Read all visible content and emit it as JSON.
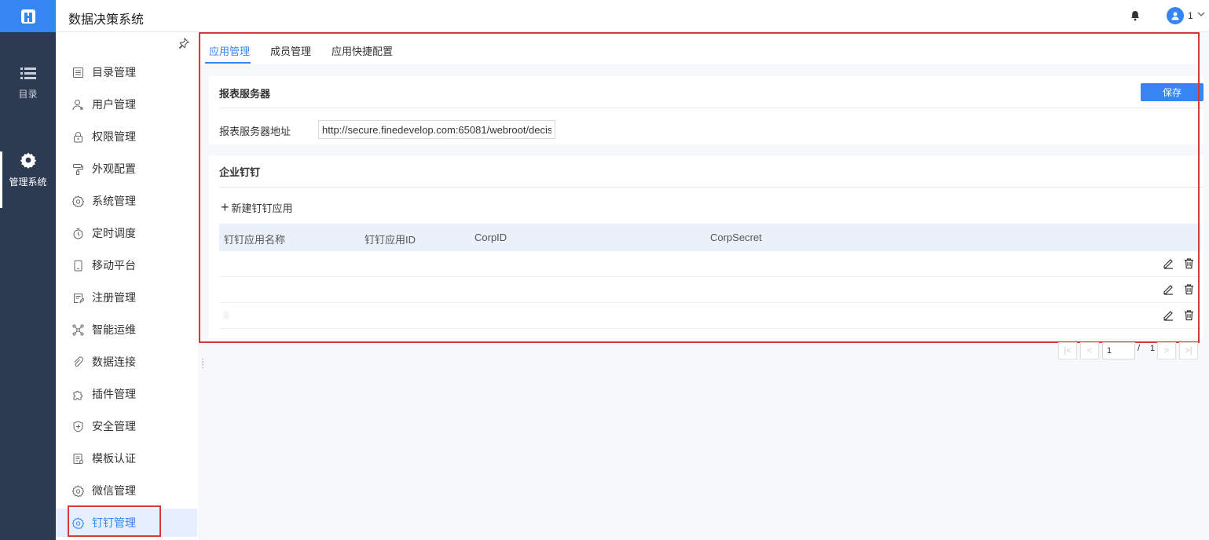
{
  "header": {
    "app_title": "数据决策系统",
    "user_name": "1",
    "icons": {
      "logo": "app-logo-icon",
      "notify": "bell-icon",
      "user": "user-avatar-icon",
      "dropdown": "chevron-down-icon"
    }
  },
  "rail": {
    "items": [
      {
        "label": "目录",
        "icon": "list-icon",
        "active": false
      },
      {
        "label": "管理系统",
        "icon": "gear-icon",
        "active": true
      }
    ]
  },
  "sidebar": {
    "items": [
      {
        "label": "目录管理",
        "icon": "catalog-icon"
      },
      {
        "label": "用户管理",
        "icon": "user-icon"
      },
      {
        "label": "权限管理",
        "icon": "lock-icon"
      },
      {
        "label": "外观配置",
        "icon": "paint-roller-icon"
      },
      {
        "label": "系统管理",
        "icon": "settings-icon"
      },
      {
        "label": "定时调度",
        "icon": "timer-icon"
      },
      {
        "label": "移动平台",
        "icon": "mobile-icon"
      },
      {
        "label": "注册管理",
        "icon": "register-icon"
      },
      {
        "label": "智能运维",
        "icon": "network-icon"
      },
      {
        "label": "数据连接",
        "icon": "link-icon"
      },
      {
        "label": "插件管理",
        "icon": "puzzle-icon"
      },
      {
        "label": "安全管理",
        "icon": "shield-icon"
      },
      {
        "label": "模板认证",
        "icon": "template-icon"
      },
      {
        "label": "微信管理",
        "icon": "wechat-gear-icon"
      },
      {
        "label": "钉钉管理",
        "icon": "dingtalk-gear-icon",
        "active": true
      }
    ]
  },
  "tabs": [
    {
      "label": "应用管理",
      "active": true
    },
    {
      "label": "成员管理",
      "active": false
    },
    {
      "label": "应用快捷配置",
      "active": false
    }
  ],
  "report_server": {
    "section_title": "报表服务器",
    "save_label": "保存",
    "address_label": "报表服务器地址",
    "address_value": "http://secure.finedevelop.com:65081/webroot/decis"
  },
  "dingtalk": {
    "section_title": "企业钉钉",
    "add_label": "新建钉钉应用",
    "columns": [
      "钉钉应用名称",
      "钉钉应用ID",
      "CorpID",
      "CorpSecret"
    ],
    "rows": [
      [
        " ",
        " ",
        " ",
        " "
      ],
      [
        "  ",
        "  ",
        "  ",
        "  "
      ],
      [
        "1",
        " ",
        " ",
        " "
      ]
    ]
  },
  "pagination": {
    "current_page": "1",
    "separator": "/",
    "total_pages": "1"
  },
  "colors": {
    "accent": "#3685f2",
    "rail_bg": "#2c3a52",
    "highlight_frame": "#d9363e"
  }
}
